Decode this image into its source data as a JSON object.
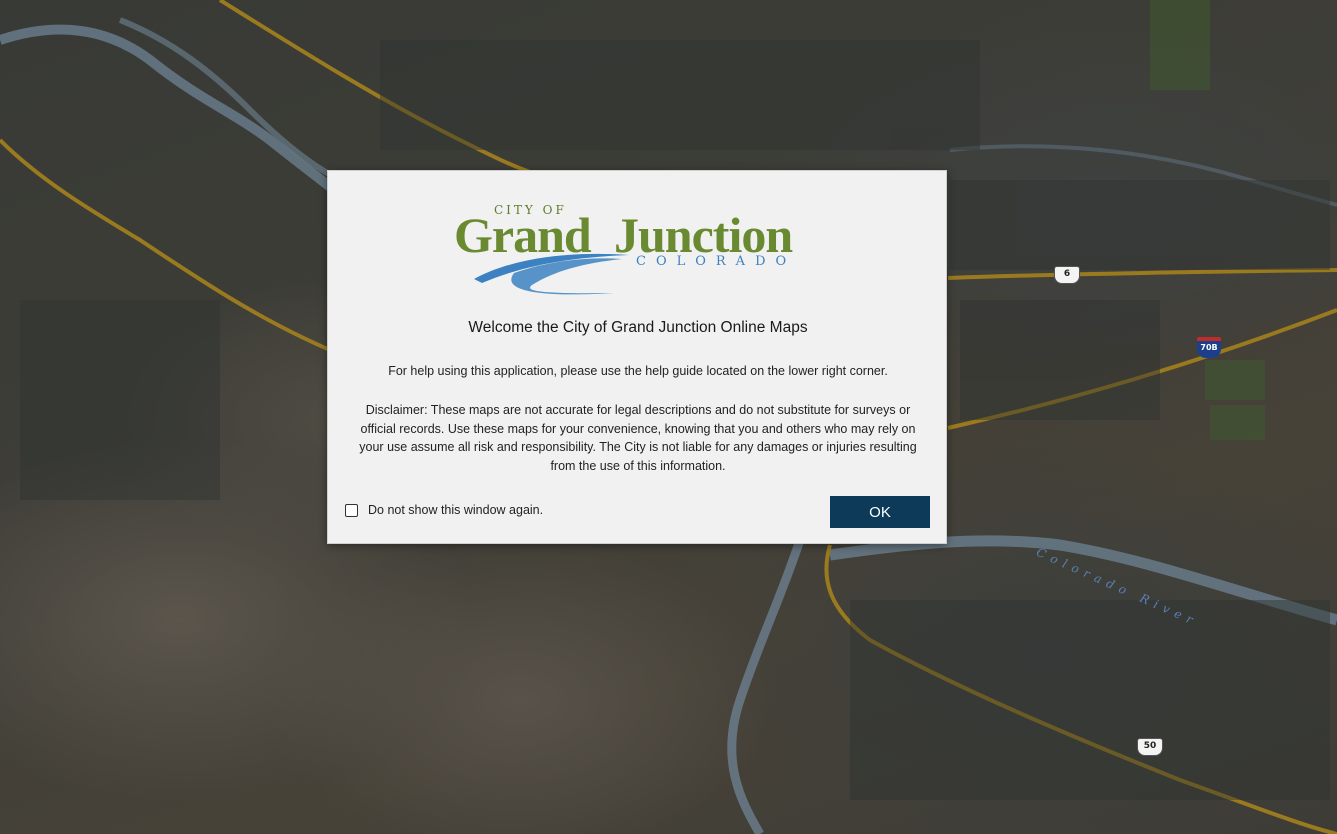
{
  "map": {
    "shields": {
      "us6": "6",
      "i70b": "70B",
      "us50": "50"
    },
    "river_label": "Colorado River",
    "colors": {
      "road": "#9a7a1e",
      "river": "#6e8394",
      "terrain": "#5b554c"
    }
  },
  "modal": {
    "logo": {
      "city_of": "CITY OF",
      "grand": "Grand",
      "junction": "Junction",
      "state": "COLORADO",
      "colors": {
        "green": "#6a8a32",
        "blue": "#3c82c2"
      }
    },
    "title": "Welcome the City of Grand Junction Online Maps",
    "help_text": "For help using this application, please use the help guide located on the lower right corner.",
    "disclaimer": "Disclaimer: These maps are not accurate for legal descriptions and do not substitute for surveys or official records. Use these maps for your convenience, knowing that you and others who may rely on your use assume all risk and responsibility. The City is not liable for any damages or injuries resulting from the use of this information.",
    "dont_show_label": "Do not show this window again.",
    "dont_show_checked": false,
    "ok_label": "OK",
    "ok_color": "#0e3a59"
  }
}
